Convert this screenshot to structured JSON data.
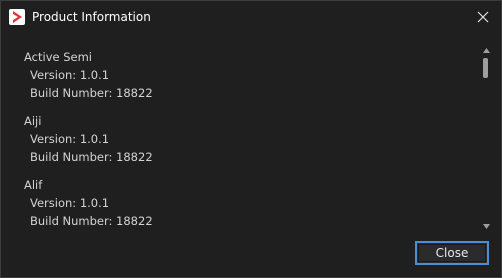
{
  "window": {
    "title": "Product Information",
    "icon": "app-logo-icon",
    "close_icon": "close-icon"
  },
  "products": [
    {
      "name": "Active Semi",
      "version": "Version: 1.0.1",
      "build": "Build Number: 18822"
    },
    {
      "name": "Aiji",
      "version": "Version: 1.0.1",
      "build": "Build Number: 18822"
    },
    {
      "name": "Alif",
      "version": "Version: 1.0.1",
      "build": "Build Number: 18822"
    }
  ],
  "footer": {
    "close_label": "Close"
  },
  "colors": {
    "accent": "#4a8fd4",
    "logo_red": "#e8303a",
    "background": "#1f1f1f"
  }
}
